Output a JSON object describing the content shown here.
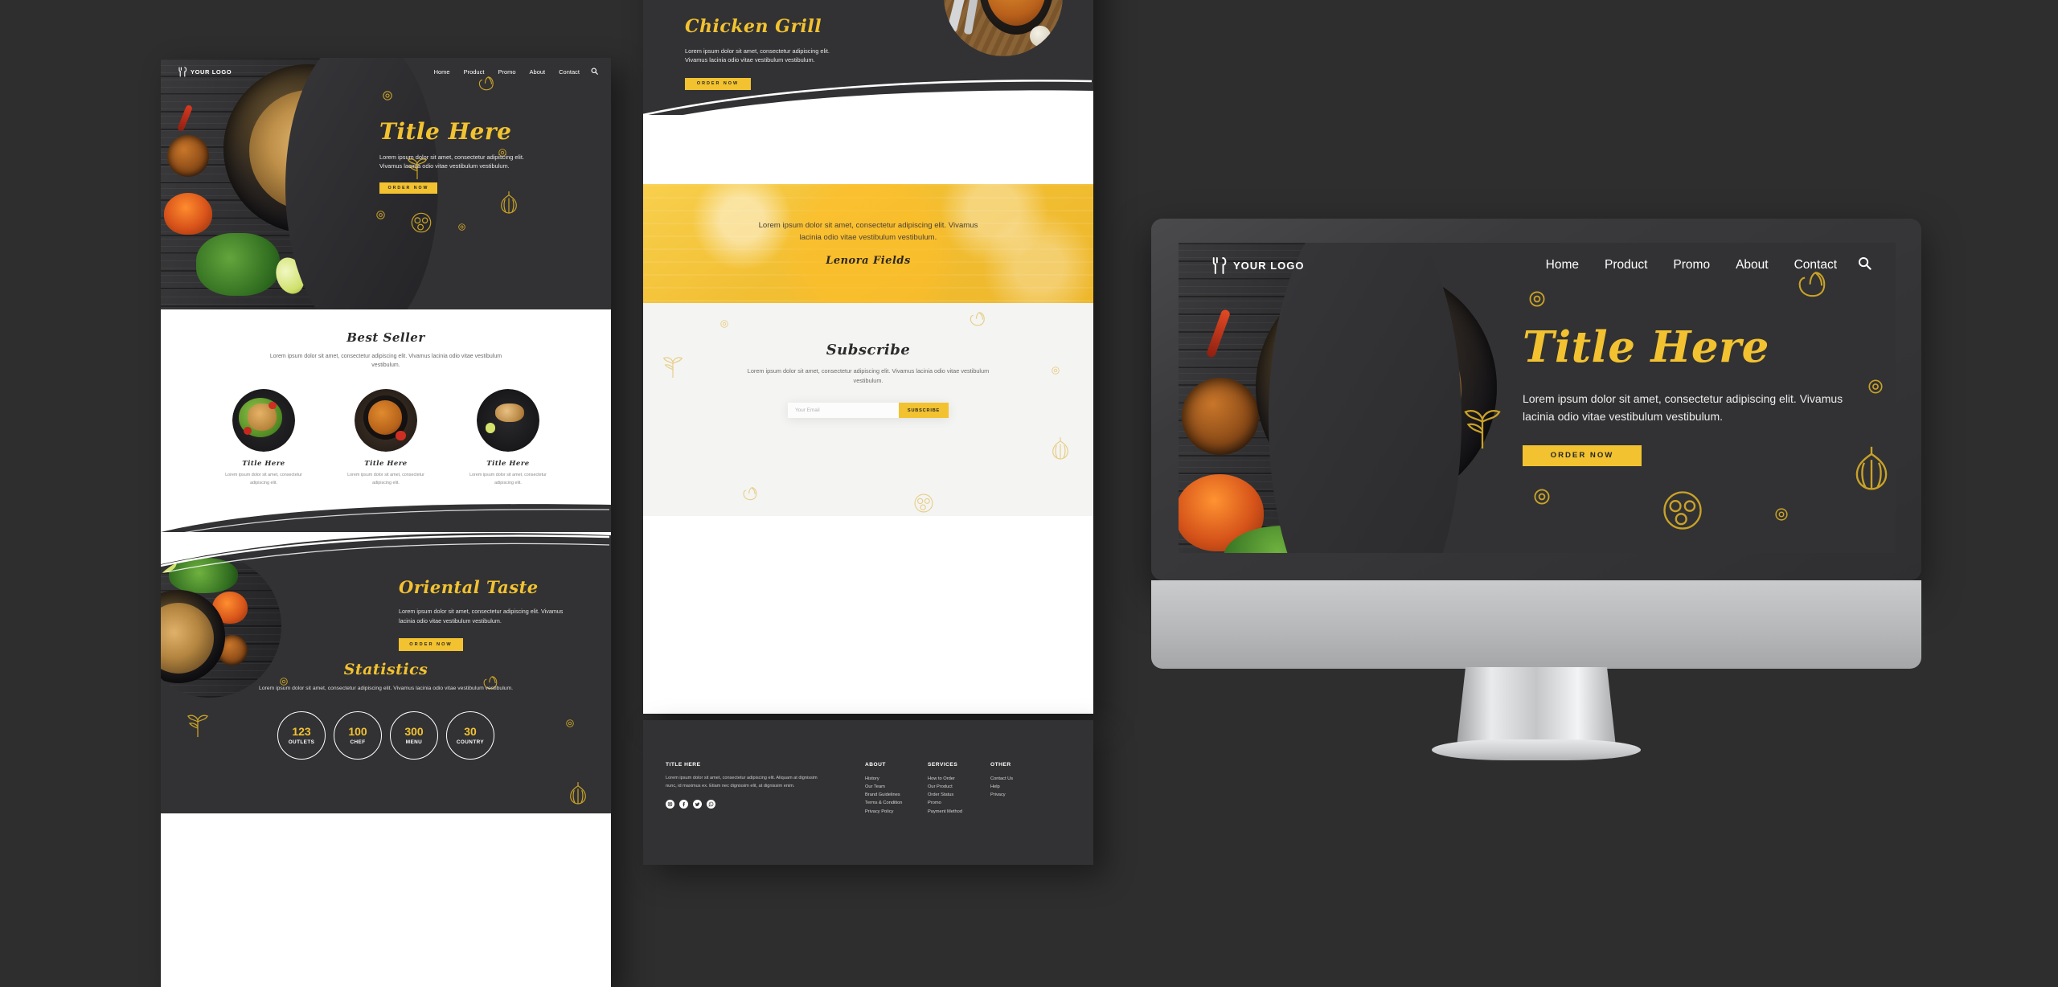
{
  "brand": {
    "logo_text": "YOUR LOGO",
    "accent": "#f2c230",
    "dark": "#323234",
    "page_bg": "#2e2e2e"
  },
  "nav": {
    "items": [
      "Home",
      "Product",
      "Promo",
      "About",
      "Contact"
    ],
    "search_icon": "search-icon"
  },
  "hero": {
    "title": "Title Here",
    "body": "Lorem ipsum dolor sit amet, consectetur adipiscing elit. Vivamus lacinia odio vitae vestibulum vestibulum.",
    "cta": "ORDER NOW"
  },
  "best_seller": {
    "title": "Best Seller",
    "subtitle": "Lorem ipsum dolor sit amet, consectetur adipiscing elit. Vivamus lacinia odio vitae vestibulum vestibulum.",
    "cards": [
      {
        "title": "Title Here",
        "body": "Lorem ipsum dolor sit amet, consectetur adipiscing elit."
      },
      {
        "title": "Title Here",
        "body": "Lorem ipsum dolor sit amet, consectetur adipiscing elit."
      },
      {
        "title": "Title Here",
        "body": "Lorem ipsum dolor sit amet, consectetur adipiscing elit."
      }
    ]
  },
  "oriental": {
    "title": "Oriental Taste",
    "body": "Lorem ipsum dolor sit amet, consectetur adipiscing elit. Vivamus lacinia odio vitae vestibulum vestibulum.",
    "cta": "ORDER NOW"
  },
  "statistics": {
    "title": "Statistics",
    "subtitle": "Lorem ipsum dolor sit amet, consectetur adipiscing elit. Vivamus lacinia odio vitae vestibulum vestibulum.",
    "items": [
      {
        "value": "123",
        "label": "OUTLETS"
      },
      {
        "value": "100",
        "label": "CHEF"
      },
      {
        "value": "300",
        "label": "MENU"
      },
      {
        "value": "30",
        "label": "COUNTRY"
      }
    ]
  },
  "grill": {
    "title": "Chicken Grill",
    "body": "Lorem ipsum dolor sit amet, consectetur adipiscing elit. Vivamus lacinia odio vitae vestibulum vestibulum.",
    "cta": "ORDER NOW"
  },
  "testimonial": {
    "quote": "Lorem ipsum dolor sit amet, consectetur adipiscing elit. Vivamus lacinia odio vitae vestibulum vestibulum.",
    "author": "Lenora Fields"
  },
  "subscribe": {
    "title": "Subscribe",
    "subtitle": "Lorem ipsum dolor sit amet, consectetur adipiscing elit. Vivamus lacinia odio vitae vestibulum vestibulum.",
    "placeholder": "Your Email",
    "value": "",
    "button": "SUBSCRIBE"
  },
  "footer": {
    "brand_title": "TITLE HERE",
    "brand_body": "Lorem ipsum dolor sit amet, consectetur adipiscing elit. Aliquam at dignissim nunc, id maximus ex. Etiam nec dignissim elit, at dignissim enim.",
    "socials": [
      "instagram-icon",
      "facebook-icon",
      "twitter-icon",
      "whatsapp-icon"
    ],
    "columns": [
      {
        "heading": "ABOUT",
        "links": [
          "History",
          "Our Team",
          "Brand Guidelines",
          "Terms & Condition",
          "Privacy Policy"
        ]
      },
      {
        "heading": "SERVICES",
        "links": [
          "How to Order",
          "Our Product",
          "Order Status",
          "Promo",
          "Payment Method"
        ]
      },
      {
        "heading": "OTHER",
        "links": [
          "Contact Us",
          "Help",
          "Privacy"
        ]
      }
    ]
  }
}
